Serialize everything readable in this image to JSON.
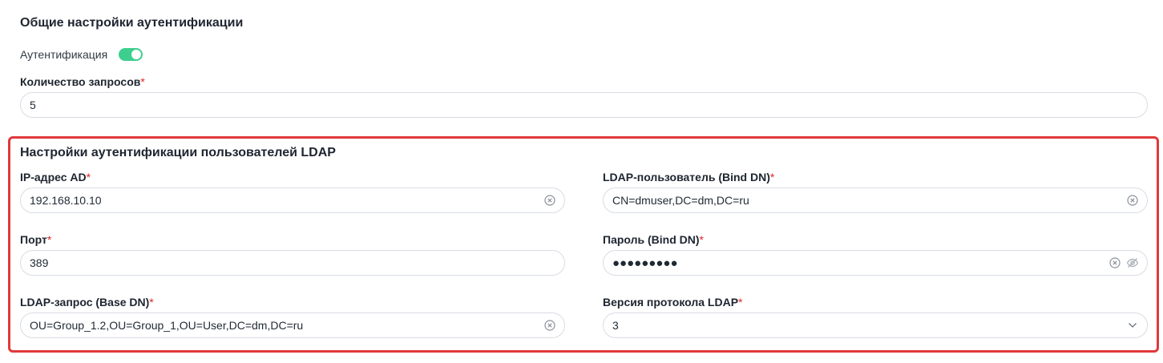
{
  "general": {
    "title": "Общие настройки аутентификации",
    "auth_toggle_label": "Аутентификация",
    "auth_enabled": true,
    "requests_label": "Количество запросов",
    "requests_value": "5"
  },
  "ldap": {
    "title": "Настройки аутентификации пользователей LDAP",
    "ip_label": "IP-адрес AD",
    "ip_value": "192.168.10.10",
    "port_label": "Порт",
    "port_value": "389",
    "base_dn_label": "LDAP-запрос (Base DN)",
    "base_dn_value": "OU=Group_1.2,OU=Group_1,OU=User,DC=dm,DC=ru",
    "bind_user_label": "LDAP-пользователь (Bind DN)",
    "bind_user_value": "CN=dmuser,DC=dm,DC=ru",
    "password_label": "Пароль (Bind DN)",
    "password_mask": "●●●●●●●●●",
    "version_label": "Версия протокола LDAP",
    "version_value": "3"
  },
  "required_mark": "*",
  "colors": {
    "accent": "#3ecf8e",
    "highlight": "#e0393b",
    "required": "#e02424"
  }
}
